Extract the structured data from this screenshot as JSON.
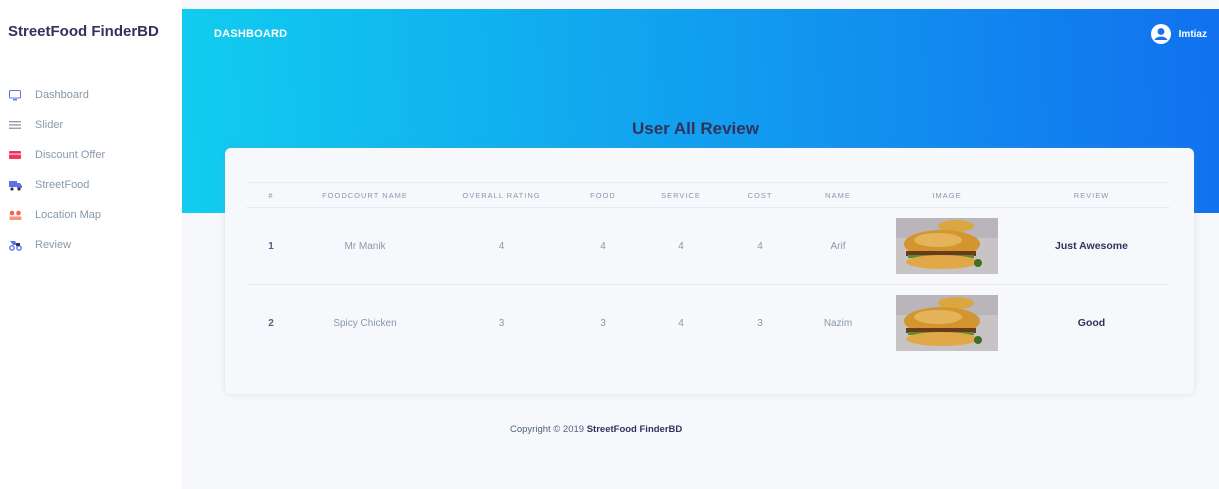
{
  "sidebar": {
    "brand": "StreetFood FinderBD",
    "items": [
      {
        "label": "Dashboard",
        "icon": "monitor-icon",
        "color": "#5e72e4"
      },
      {
        "label": "Slider",
        "icon": "list-icon",
        "color": "#8898aa"
      },
      {
        "label": "Discount Offer",
        "icon": "tag-icon",
        "color": "#f5365c"
      },
      {
        "label": "StreetFood",
        "icon": "truck-icon",
        "color": "#5e72e4"
      },
      {
        "label": "Location Map",
        "icon": "location-icon",
        "color": "#fb6340"
      },
      {
        "label": "Review",
        "icon": "bike-icon",
        "color": "#5e72e4"
      }
    ]
  },
  "header": {
    "title": "DASHBOARD",
    "user_name": "Imtiaz",
    "gradient_start": "#11cdef",
    "gradient_end": "#1171ef"
  },
  "page_title": "User All Review",
  "table": {
    "columns": [
      "#",
      "FOODCOURT NAME",
      "OVERALL RATING",
      "FOOD",
      "SERVICE",
      "COST",
      "NAME",
      "IMAGE",
      "REVIEW"
    ],
    "rows": [
      {
        "index": "1",
        "foodcourt": "Mr Manik",
        "overall": "4",
        "food": "4",
        "service": "4",
        "cost": "4",
        "name": "Arif",
        "image": "burger-image",
        "review": "Just Awesome"
      },
      {
        "index": "2",
        "foodcourt": "Spicy Chicken",
        "overall": "3",
        "food": "3",
        "service": "4",
        "cost": "3",
        "name": "Nazim",
        "image": "burger-image",
        "review": "Good"
      }
    ]
  },
  "footer": {
    "prefix": "Copyright © 2019 ",
    "brand": "StreetFood FinderBD"
  }
}
